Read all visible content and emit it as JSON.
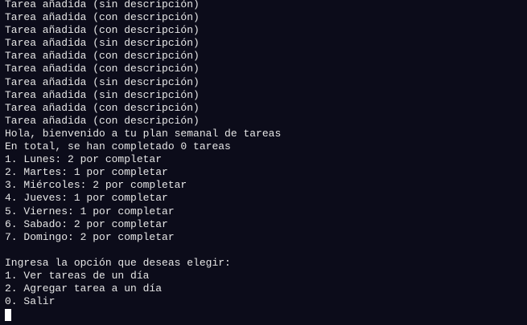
{
  "terminal": {
    "lines": [
      "Tarea añadida (sin descripción)",
      "Tarea añadida (con descripción)",
      "Tarea añadida (con descripción)",
      "Tarea añadida (sin descripción)",
      "Tarea añadida (con descripción)",
      "Tarea añadida (con descripción)",
      "Tarea añadida (sin descripción)",
      "Tarea añadida (sin descripción)",
      "Tarea añadida (con descripción)",
      "Tarea añadida (con descripción)",
      "Hola, bienvenido a tu plan semanal de tareas",
      "En total, se han completado 0 tareas",
      "1. Lunes: 2 por completar",
      "2. Martes: 1 por completar",
      "3. Miércoles: 2 por completar",
      "4. Jueves: 1 por completar",
      "5. Viernes: 1 por completar",
      "6. Sabado: 2 por completar",
      "7. Domingo: 2 por completar",
      "",
      "Ingresa la opción que deseas elegir:",
      "1. Ver tareas de un día",
      "2. Agregar tarea a un día",
      "0. Salir"
    ]
  },
  "colors": {
    "background": "#0c0c1a",
    "foreground": "#e6e6e6",
    "cursor": "#ffffff"
  }
}
